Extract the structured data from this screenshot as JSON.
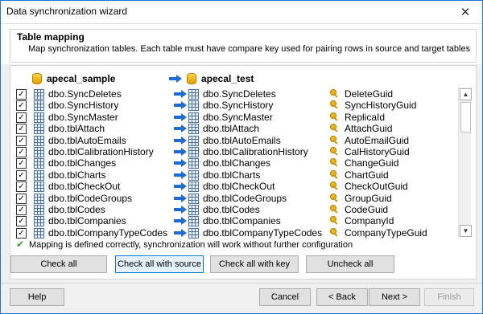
{
  "window": {
    "title": "Data synchronization wizard",
    "close_glyph": "✕"
  },
  "header": {
    "title": "Table mapping",
    "subtitle": "Map synchronization tables. Each table must have compare key used for pairing rows in source and target tables"
  },
  "source_db": "apecal_sample",
  "target_db": "apecal_test",
  "rows": [
    {
      "checked": true,
      "source": "dbo.SyncDeletes",
      "target": "dbo.SyncDeletes",
      "key": "DeleteGuid"
    },
    {
      "checked": true,
      "source": "dbo.SyncHistory",
      "target": "dbo.SyncHistory",
      "key": "SyncHistoryGuid"
    },
    {
      "checked": true,
      "source": "dbo.SyncMaster",
      "target": "dbo.SyncMaster",
      "key": "ReplicaId"
    },
    {
      "checked": true,
      "source": "dbo.tblAttach",
      "target": "dbo.tblAttach",
      "key": "AttachGuid"
    },
    {
      "checked": true,
      "source": "dbo.tblAutoEmails",
      "target": "dbo.tblAutoEmails",
      "key": "AutoEmailGuid"
    },
    {
      "checked": true,
      "source": "dbo.tblCalibrationHistory",
      "target": "dbo.tblCalibrationHistory",
      "key": "CalHistoryGuid"
    },
    {
      "checked": true,
      "source": "dbo.tblChanges",
      "target": "dbo.tblChanges",
      "key": "ChangeGuid"
    },
    {
      "checked": true,
      "source": "dbo.tblCharts",
      "target": "dbo.tblCharts",
      "key": "ChartGuid"
    },
    {
      "checked": true,
      "source": "dbo.tblCheckOut",
      "target": "dbo.tblCheckOut",
      "key": "CheckOutGuid"
    },
    {
      "checked": true,
      "source": "dbo.tblCodeGroups",
      "target": "dbo.tblCodeGroups",
      "key": "GroupGuid"
    },
    {
      "checked": true,
      "source": "dbo.tblCodes",
      "target": "dbo.tblCodes",
      "key": "CodeGuid"
    },
    {
      "checked": true,
      "source": "dbo.tblCompanies",
      "target": "dbo.tblCompanies",
      "key": "CompanyId"
    },
    {
      "checked": true,
      "source": "dbo.tblCompanyTypeCodes",
      "target": "dbo.tblCompanyTypeCodes",
      "key": "CompanyTypeGuid"
    }
  ],
  "status": "Mapping is defined correctly, synchronization will work without further configuration",
  "actions": {
    "check_all": "Check all",
    "check_all_source": "Check all with source",
    "check_all_key": "Check all with key",
    "uncheck_all": "Uncheck all"
  },
  "footer": {
    "help": "Help",
    "cancel": "Cancel",
    "back": "< Back",
    "next": "Next >",
    "finish": "Finish"
  }
}
